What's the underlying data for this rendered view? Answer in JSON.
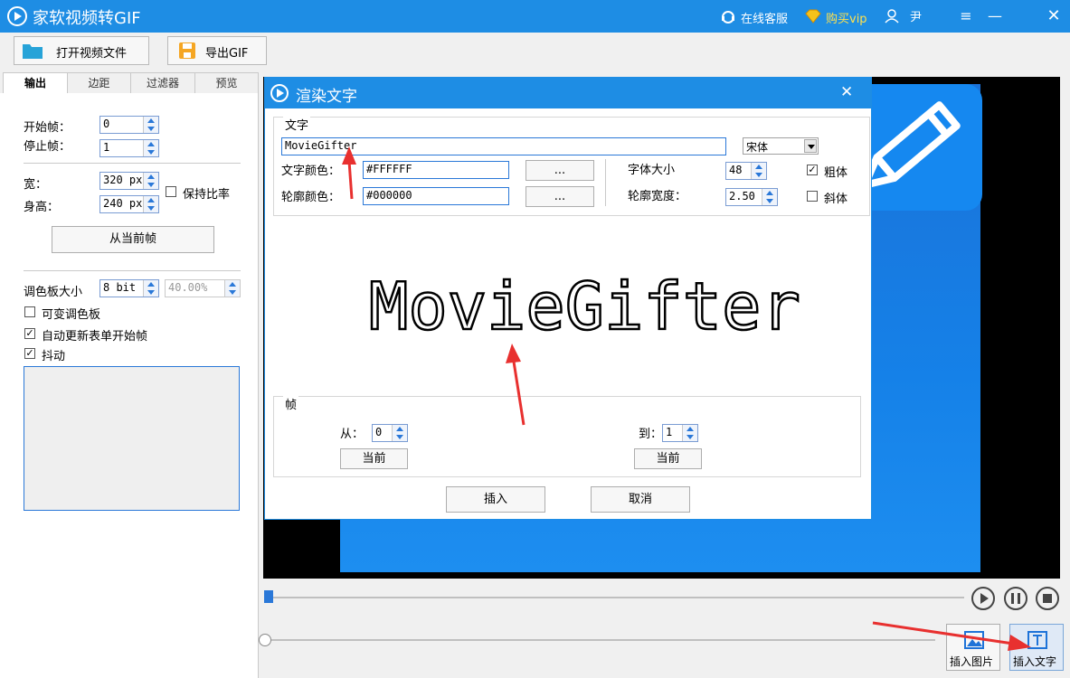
{
  "app": {
    "title": "家软视频转GIF",
    "online_service": "在线客服",
    "buy_vip": "购买vip",
    "user": "尹"
  },
  "toolbar": {
    "open_video": "打开视频文件",
    "export_gif": "导出GIF"
  },
  "tabs": [
    "输出",
    "边距",
    "过滤器",
    "预览"
  ],
  "output": {
    "start_frame_label": "开始帧：",
    "start_frame": "0",
    "stop_frame_label": "停止帧：",
    "stop_frame": "1",
    "width_label": "宽：",
    "width": "320 px",
    "height_label": "身高：",
    "height": "240 px",
    "keep_ratio_label": "保持比率",
    "keep_ratio": false,
    "from_current_frame": "从当前帧",
    "palette_label": "调色板大小",
    "palette_bits": "8 bit",
    "palette_percent": "40.00%",
    "variable_palette_label": "可变调色板",
    "variable_palette": false,
    "auto_update_label": "自动更新表单开始帧",
    "auto_update": true,
    "dither_label": "抖动",
    "dither": true
  },
  "dialog": {
    "title": "渲染文字",
    "text_group": "文字",
    "text_value": "MovieGifter",
    "font_name": "宋体",
    "text_color_label": "文字颜色：",
    "text_color": "#FFFFFF",
    "outline_color_label": "轮廓颜色：",
    "outline_color": "#000000",
    "pick_button": "...",
    "font_size_label": "字体大小",
    "font_size": "48",
    "outline_width_label": "轮廓宽度：",
    "outline_width": "2.50",
    "bold_label": "粗体",
    "bold": true,
    "italic_label": "斜体",
    "italic": false,
    "preview_text": "MovieGifter",
    "frame_group": "帧",
    "from_label": "从：",
    "from_value": "0",
    "to_label": "到：",
    "to_value": "1",
    "current_button": "当前",
    "insert_button": "插入",
    "cancel_button": "取消"
  },
  "bottom": {
    "insert_image": "插入图片",
    "insert_text": "插入文字"
  },
  "colors": {
    "accent": "#1e8de4",
    "arrow": "#e8302f"
  }
}
